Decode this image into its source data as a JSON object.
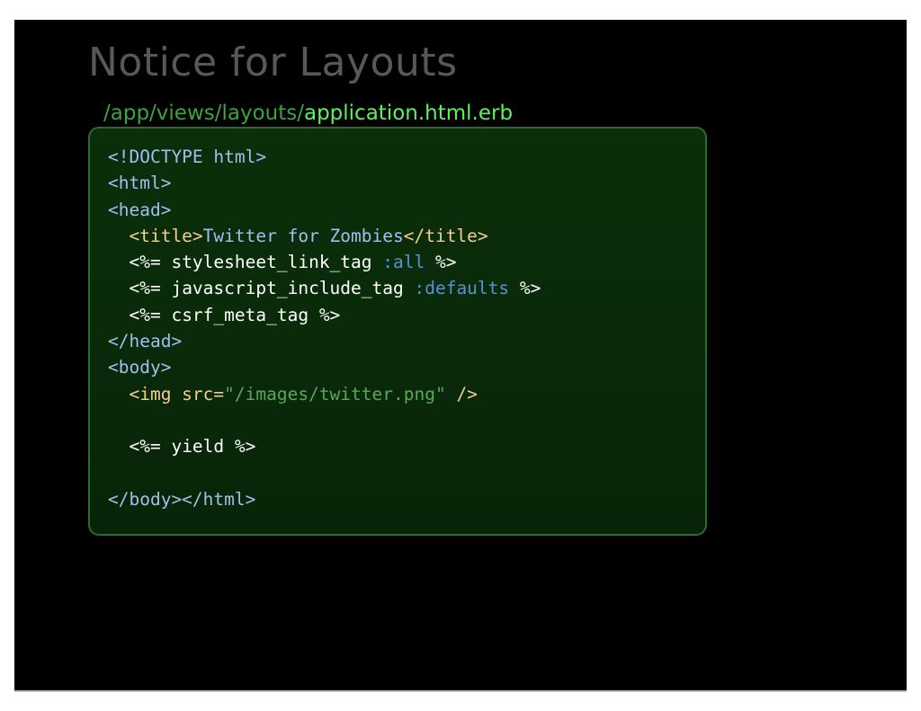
{
  "slide": {
    "title": "Notice for Layouts",
    "file_path": {
      "directory": "/app/views/layouts/",
      "filename": "application.html.erb"
    },
    "code_lines": [
      "<!DOCTYPE html>",
      "<html>",
      "<head>",
      "  <title>Twitter for Zombies</title>",
      "  <%= stylesheet_link_tag :all %>",
      "  <%= javascript_include_tag :defaults %>",
      "  <%= csrf_meta_tag %>",
      "</head>",
      "<body>",
      "  <img src=\"/images/twitter.png\" />",
      "",
      "  <%= yield %>",
      "",
      "</body></html>"
    ],
    "tokens": {
      "doctype": "<!DOCTYPE html>",
      "html_open": "<html>",
      "head_open": "<head>",
      "indent": "  ",
      "title_open": "<title>",
      "title_text": "Twitter for Zombies",
      "title_close": "</title>",
      "erb_open": "<%= ",
      "erb_close": " %>",
      "stylesheet_helper": "stylesheet_link_tag",
      "stylesheet_arg": ":all",
      "javascript_helper": "javascript_include_tag",
      "javascript_arg": ":defaults",
      "csrf_helper": "csrf_meta_tag",
      "head_close": "</head>",
      "body_open": "<body>",
      "img_start": "<img src=",
      "img_src": "\"/images/twitter.png\"",
      "img_end": " />",
      "yield_keyword": "yield",
      "body_html_close": "</body></html>",
      "space": " "
    }
  },
  "colors": {
    "slide_background": "#000000",
    "title": "#585858",
    "path_directory": "#3aa53a",
    "path_filename": "#5cf25c",
    "code_box_background": "#0a2a0a",
    "code_box_border": "#2d6a2d",
    "code_tag": "#9fc0ee",
    "code_tag_highlight": "#f2cf8c",
    "code_symbol": "#5b8fd6",
    "code_string": "#58a858",
    "code_plain": "#ffffff"
  }
}
